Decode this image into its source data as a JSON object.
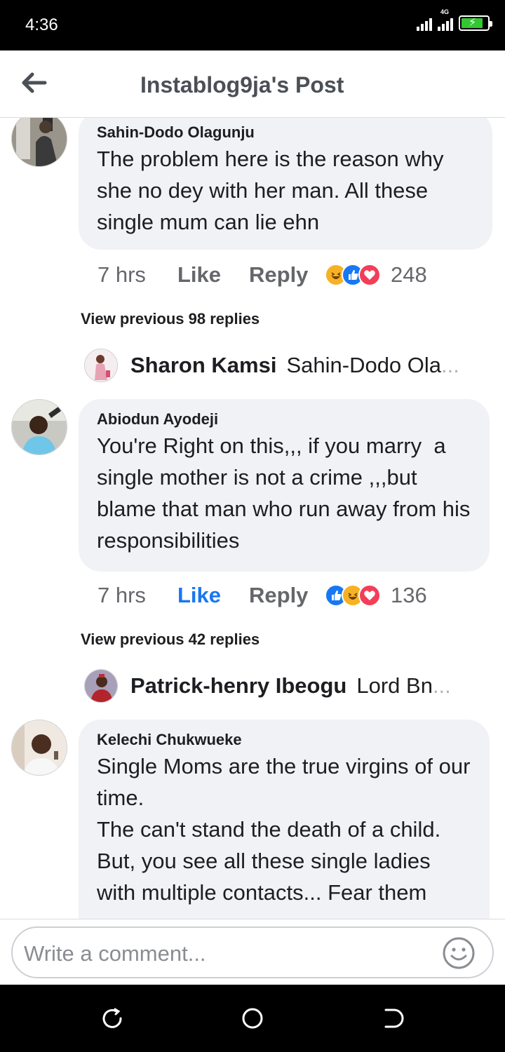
{
  "status_bar": {
    "time": "4:36",
    "network": "4G"
  },
  "header": {
    "title": "Instablog9ja's Post"
  },
  "comments": [
    {
      "author": "Sahin-Dodo Olagunju",
      "text": "The problem here is the reason why she no dey with her man. All these single mum can lie ehn",
      "time": "7 hrs",
      "like_label": "Like",
      "reply_label": "Reply",
      "reactions": [
        "haha-icon",
        "like-icon",
        "love-icon"
      ],
      "reaction_count": "248",
      "view_previous": "View previous 98 replies",
      "latest_reply": {
        "author": "Sharon Kamsi",
        "snippet": "Sahin-Dodo Ola",
        "ellipsis": "..."
      }
    },
    {
      "author": "Abiodun Ayodeji",
      "text": "You're Right on this,,, if you marry  a single mother is not a crime ,,,but blame that man who run away from his responsibilities",
      "time": "7 hrs",
      "like_label": "Like",
      "reply_label": "Reply",
      "liked": true,
      "reactions": [
        "like-icon",
        "haha-icon",
        "love-icon"
      ],
      "reaction_count": "136",
      "view_previous": "View previous 42 replies",
      "latest_reply": {
        "author": "Patrick-henry Ibeogu",
        "snippet": "Lord Bn",
        "ellipsis": "..."
      }
    },
    {
      "author": "Kelechi Chukwueke",
      "text": "Single Moms are the true virgins of our time.\nThe can't stand the death of a child.\nBut, you see all these single ladies with multiple contacts... Fear them"
    }
  ],
  "composer": {
    "placeholder": "Write a comment..."
  },
  "colors": {
    "accent": "#1877f2",
    "bubble": "#f0f2f5",
    "muted": "#65676b"
  }
}
